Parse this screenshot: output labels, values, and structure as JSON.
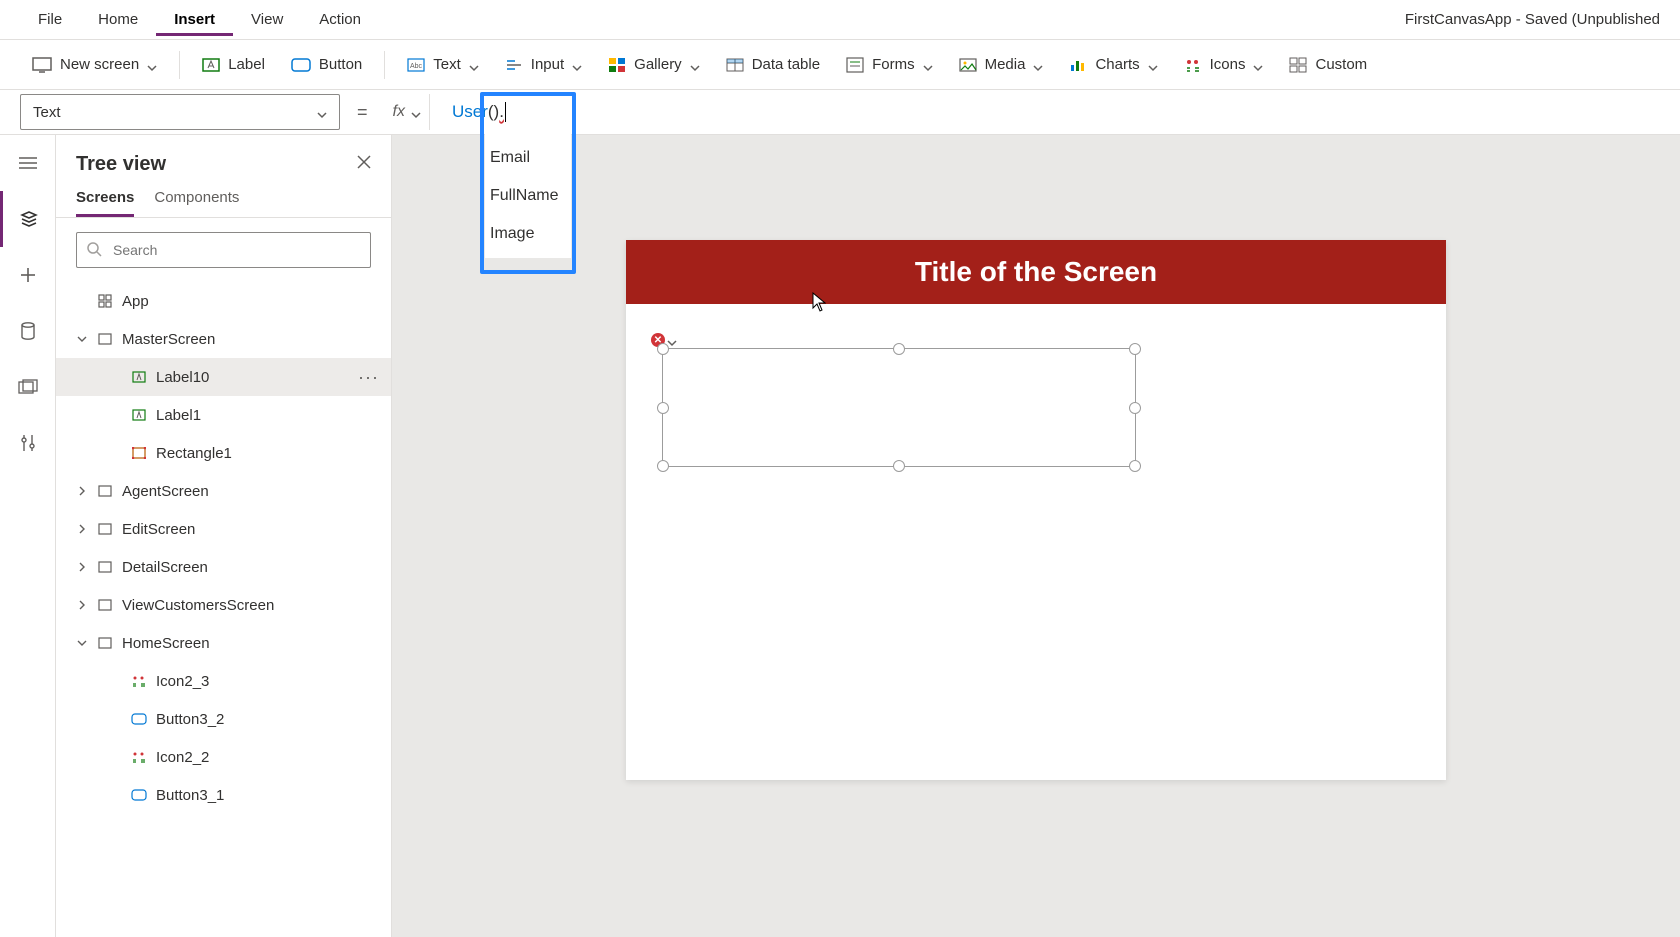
{
  "app_title": "FirstCanvasApp - Saved (Unpublished",
  "top_menu": {
    "file": "File",
    "home": "Home",
    "insert": "Insert",
    "view": "View",
    "action": "Action"
  },
  "ribbon": {
    "new_screen": "New screen",
    "label": "Label",
    "button": "Button",
    "text": "Text",
    "input": "Input",
    "gallery": "Gallery",
    "data_table": "Data table",
    "forms": "Forms",
    "media": "Media",
    "charts": "Charts",
    "icons": "Icons",
    "custom": "Custom"
  },
  "formula_bar": {
    "property": "Text",
    "equals": "=",
    "fx": "fx",
    "expression_func": "User",
    "expression_parens": "()",
    "expression_dot": "."
  },
  "autocomplete": {
    "item1": "Email",
    "item2": "FullName",
    "item3": "Image"
  },
  "tree_panel": {
    "title": "Tree view",
    "tab_screens": "Screens",
    "tab_components": "Components",
    "search_placeholder": "Search",
    "app_node": "App",
    "master_screen": "MasterScreen",
    "label10": "Label10",
    "label1": "Label1",
    "rectangle1": "Rectangle1",
    "agent_screen": "AgentScreen",
    "edit_screen": "EditScreen",
    "detail_screen": "DetailScreen",
    "view_customers_screen": "ViewCustomersScreen",
    "home_screen": "HomeScreen",
    "icon2_3": "Icon2_3",
    "button3_2": "Button3_2",
    "icon2_2": "Icon2_2",
    "button3_1": "Button3_1",
    "more": "···"
  },
  "canvas": {
    "screen_title": "Title of the Screen"
  },
  "colors": {
    "accent_purple": "#742774",
    "title_bar_red": "#a32019",
    "error_red": "#d13438",
    "link_blue": "#0078d4"
  }
}
